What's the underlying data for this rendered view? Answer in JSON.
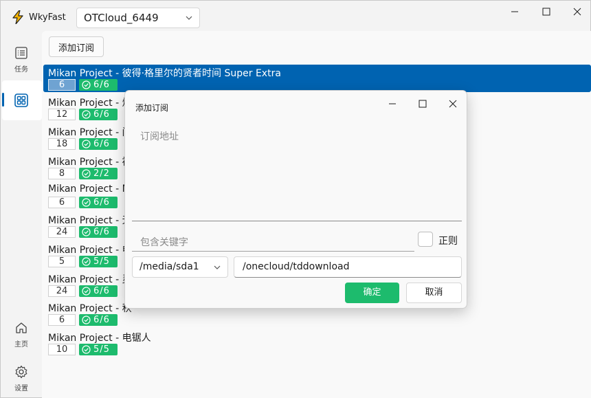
{
  "app": {
    "title": "WkyFast",
    "profile": "OTCloud_6449"
  },
  "nav": {
    "tasks_label": "任务",
    "home_label": "主页",
    "settings_label": "设置"
  },
  "toolbar": {
    "add_label": "添加订阅"
  },
  "subscriptions": [
    {
      "title": "Mikan Project - 彼得·格里尔的贤者时间 Super Extra",
      "count": "6",
      "status": "6/6",
      "selected": true
    },
    {
      "title": "Mikan Project - 烦",
      "count": "12",
      "status": "6/6"
    },
    {
      "title": "Mikan Project - 间",
      "count": "18",
      "status": "6/6"
    },
    {
      "title": "Mikan Project - 被",
      "count": "8",
      "status": "2/2"
    },
    {
      "title": "Mikan Project - M",
      "count": "6",
      "status": "6/6"
    },
    {
      "title": "Mikan Project - 无",
      "count": "24",
      "status": "6/6"
    },
    {
      "title": "Mikan Project - 电",
      "count": "5",
      "status": "5/5"
    },
    {
      "title": "Mikan Project - 灵",
      "count": "24",
      "status": "6/6"
    },
    {
      "title": "Mikan Project - 秋",
      "count": "6",
      "status": "6/6"
    },
    {
      "title": "Mikan Project - 电锯人",
      "count": "10",
      "status": "5/5"
    }
  ],
  "dialog": {
    "title": "添加订阅",
    "url_placeholder": "订阅地址",
    "keyword_placeholder": "包含关键字",
    "regex_label": "正则",
    "mount_path": "/media/sda1",
    "download_path": "/onecloud/tddownload",
    "ok_label": "确定",
    "cancel_label": "取消"
  },
  "colors": {
    "accent": "#0063b1",
    "success": "#1dbb6d"
  }
}
